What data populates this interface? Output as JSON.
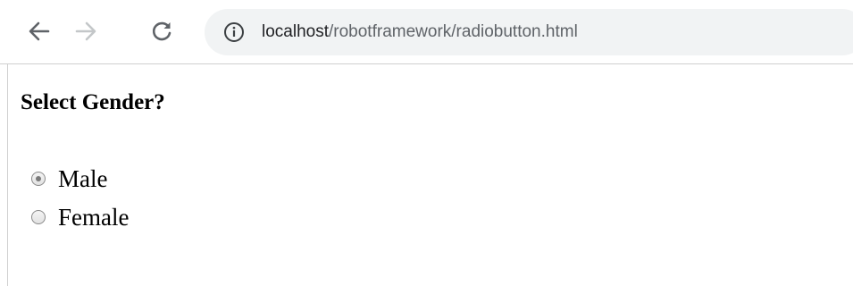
{
  "browser": {
    "icons": {
      "back": "back-arrow-icon",
      "forward": "forward-arrow-icon",
      "reload": "reload-icon",
      "site_info": "info-icon"
    },
    "url": {
      "host": "localhost",
      "path": "/robotframework/radiobutton.html"
    }
  },
  "content": {
    "heading": "Select Gender?",
    "options": [
      {
        "label": "Male",
        "selected": true
      },
      {
        "label": "Female",
        "selected": false
      }
    ]
  },
  "colors": {
    "icon_active": "#5f6368",
    "icon_disabled": "#c4c7c9",
    "omnibox_bg": "#f1f3f4",
    "url_host": "#202124",
    "url_path": "#5f6368",
    "radio_dot": "#7a7a7a"
  }
}
